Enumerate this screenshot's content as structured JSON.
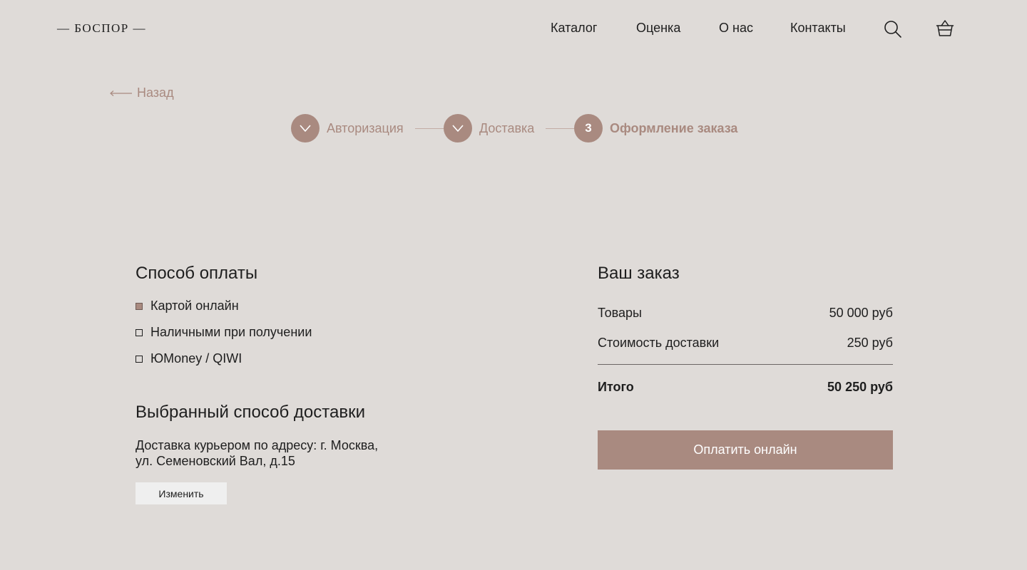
{
  "header": {
    "logo": "— БОСПОР —",
    "nav": [
      {
        "label": "Каталог"
      },
      {
        "label": "Оценка"
      },
      {
        "label": "О нас"
      },
      {
        "label": "Контакты"
      }
    ],
    "icons": {
      "search": "search-icon",
      "cart": "basket-icon"
    }
  },
  "back": {
    "label": "Назад"
  },
  "stepper": {
    "steps": [
      {
        "label": "Авторизация",
        "state": "done"
      },
      {
        "label": "Доставка",
        "state": "done"
      },
      {
        "number": "3",
        "label": "Оформление заказа",
        "state": "active"
      }
    ]
  },
  "payment": {
    "title": "Способ оплаты",
    "options": [
      {
        "label": "Картой онлайн",
        "checked": true
      },
      {
        "label": "Наличными при получении",
        "checked": false
      },
      {
        "label": "ЮMoney / QIWI",
        "checked": false
      }
    ]
  },
  "delivery": {
    "title": "Выбранный способ доставки",
    "line1": "Доставка курьером по адресу: г. Москва,",
    "line2": "ул. Семеновский Вал, д.15",
    "change_label": "Изменить"
  },
  "order": {
    "title": "Ваш заказ",
    "rows": [
      {
        "label": "Товары",
        "value": "50 000 руб"
      },
      {
        "label": "Стоимость доставки",
        "value": "250 руб"
      }
    ],
    "total": {
      "label": "Итого",
      "value": "50 250 руб"
    },
    "pay_label": "Оплатить онлайн"
  },
  "colors": {
    "background": "#dfdbd8",
    "accent": "#a98a80",
    "text": "#1e1e1e",
    "button_light": "#efefef"
  }
}
